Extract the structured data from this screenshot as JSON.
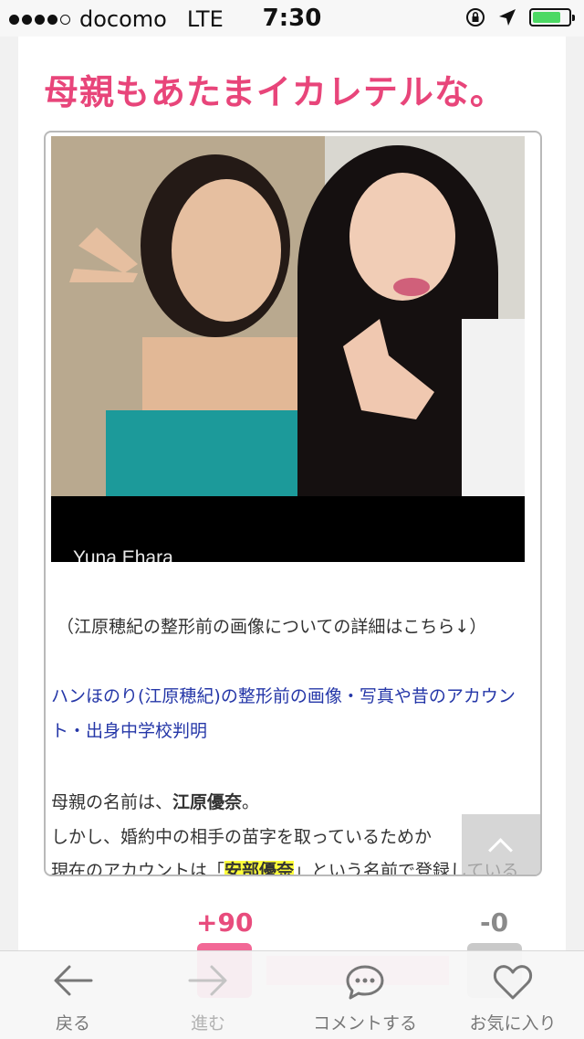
{
  "status_bar": {
    "carrier": "docomo",
    "network": "LTE",
    "time": "7:30",
    "battery_level": 0.8
  },
  "article": {
    "heading": "母親もあたまイカレテルな。",
    "photo_caption": "Yuna Ehara",
    "paragraph_details": "（江原穂紀の整形前の画像についての詳細はこちら↓）",
    "link_line1": "ハンほのり(江原穂紀)の整形前の画像・写真や昔のアカウン",
    "link_line2": "ト・出身中学校判明",
    "mother_prefix": "母親の名前は、",
    "mother_name": "江原優奈",
    "mother_suffix": "。",
    "line_however": "しかし、婚約中の相手の苗字を取っているためか",
    "account_prefix": "現在のアカウントは「",
    "account_name": "安部優奈",
    "account_suffix": "」という名前で登録している"
  },
  "votes": {
    "plus": "+90",
    "minus": "-0"
  },
  "toolbar": {
    "back": "戻る",
    "forward": "進む",
    "comment": "コメントする",
    "favorite": "お気に入り"
  },
  "colors": {
    "accent_pink": "#e8457a",
    "link_blue": "#2537a8",
    "highlight": "#ffff3a"
  },
  "icons": [
    "arrow-left-icon",
    "arrow-right-icon",
    "speech-bubble-icon",
    "heart-icon",
    "chevron-up-icon",
    "location-arrow-icon",
    "rotation-lock-icon"
  ]
}
